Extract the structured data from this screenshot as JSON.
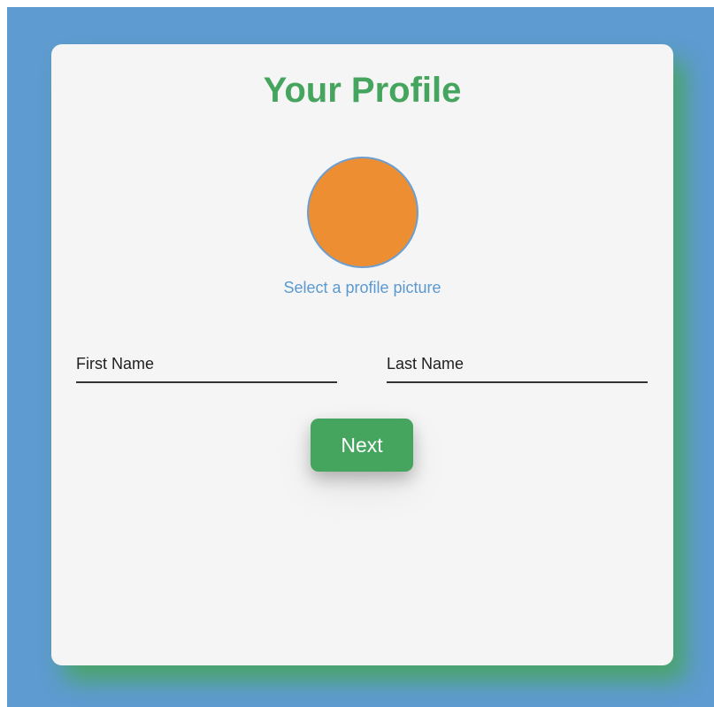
{
  "page": {
    "background_color": "#5e9bd1",
    "card_color": "#f5f5f5",
    "accent_color": "#45a55e",
    "avatar_color": "#ee8e33",
    "link_color": "#5b99d0"
  },
  "profile": {
    "title": "Your Profile",
    "avatar_prompt": "Select a profile picture",
    "first_name_label": "First Name",
    "last_name_label": "Last Name",
    "first_name_value": "",
    "last_name_value": "",
    "next_label": "Next"
  }
}
